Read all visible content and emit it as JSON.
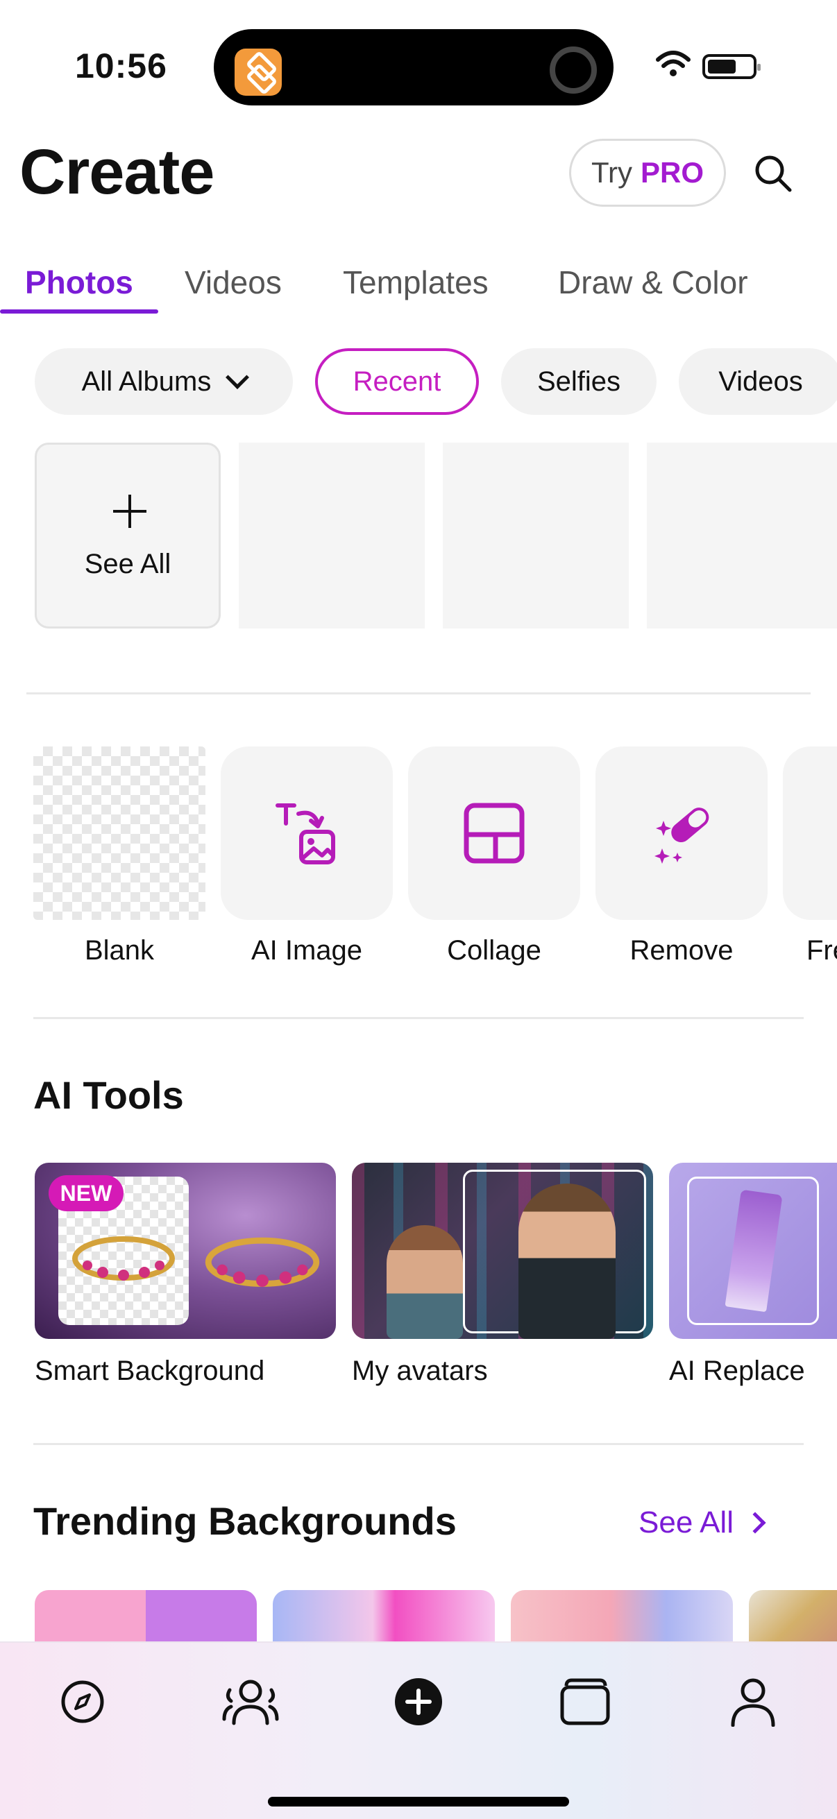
{
  "status_bar": {
    "time": "10:56"
  },
  "header": {
    "title": "Create",
    "try_label": "Try",
    "pro_label": "PRO"
  },
  "tabs": [
    {
      "label": "Photos",
      "active": true
    },
    {
      "label": "Videos"
    },
    {
      "label": "Templates"
    },
    {
      "label": "Draw & Color"
    }
  ],
  "album_chips": [
    {
      "label": "All Albums",
      "dropdown": true
    },
    {
      "label": "Recent",
      "selected": true
    },
    {
      "label": "Selfies"
    },
    {
      "label": "Videos"
    }
  ],
  "recent": {
    "see_all_label": "See All"
  },
  "tools": [
    {
      "label": "Blank",
      "icon": "transparent-canvas-icon"
    },
    {
      "label": "AI Image",
      "icon": "text-to-image-icon"
    },
    {
      "label": "Collage",
      "icon": "collage-layout-icon"
    },
    {
      "label": "Remove",
      "icon": "eraser-sparkle-icon"
    },
    {
      "label": "Fre",
      "icon": ""
    }
  ],
  "ai_tools": {
    "title": "AI Tools",
    "cards": [
      {
        "label": "Smart Background",
        "badge": "NEW"
      },
      {
        "label": "My avatars"
      },
      {
        "label": "AI Replace"
      }
    ]
  },
  "trending": {
    "title": "Trending Backgrounds",
    "see_all_label": "See All"
  },
  "tab_bar": [
    {
      "name": "discover",
      "icon": "compass-icon"
    },
    {
      "name": "community",
      "icon": "people-icon"
    },
    {
      "name": "create",
      "icon": "plus-circle-icon"
    },
    {
      "name": "projects",
      "icon": "folders-icon"
    },
    {
      "name": "profile",
      "icon": "person-icon"
    }
  ],
  "colors": {
    "accent": "#7a1bd6",
    "magenta": "#c51ec1",
    "pro": "#a31bd0"
  }
}
